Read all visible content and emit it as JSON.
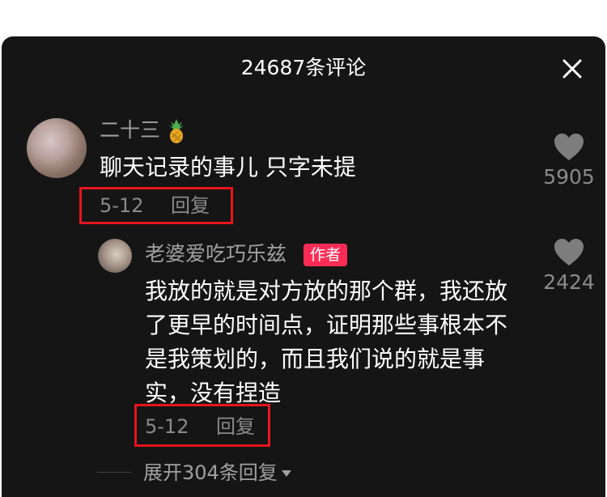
{
  "header": {
    "title": "24687条评论",
    "close_icon": "close-icon"
  },
  "comments": [
    {
      "username": "二十三",
      "username_icon": "pineapple-icon",
      "text": "聊天记录的事儿 只字未提",
      "date": "5-12",
      "reply_label": "回复",
      "likes": "5905",
      "like_icon": "heart-icon"
    }
  ],
  "replies": [
    {
      "username": "老婆爱吃巧乐兹",
      "badge": "作者",
      "text": "我放的就是对方放的那个群，我还放了更早的时间点，证明那些事根本不是我策划的，而且我们说的就是事实，没有捏造",
      "date": "5-12",
      "reply_label": "回复",
      "likes": "2424",
      "like_icon": "heart-icon"
    }
  ],
  "expand": {
    "label": "展开304条回复",
    "icon": "caret-down-icon"
  },
  "colors": {
    "background": "#151515",
    "text_primary": "#ffffff",
    "text_secondary": "#8a8a8a",
    "author_badge": "#fe2c55",
    "highlight_box": "#e8141c"
  }
}
